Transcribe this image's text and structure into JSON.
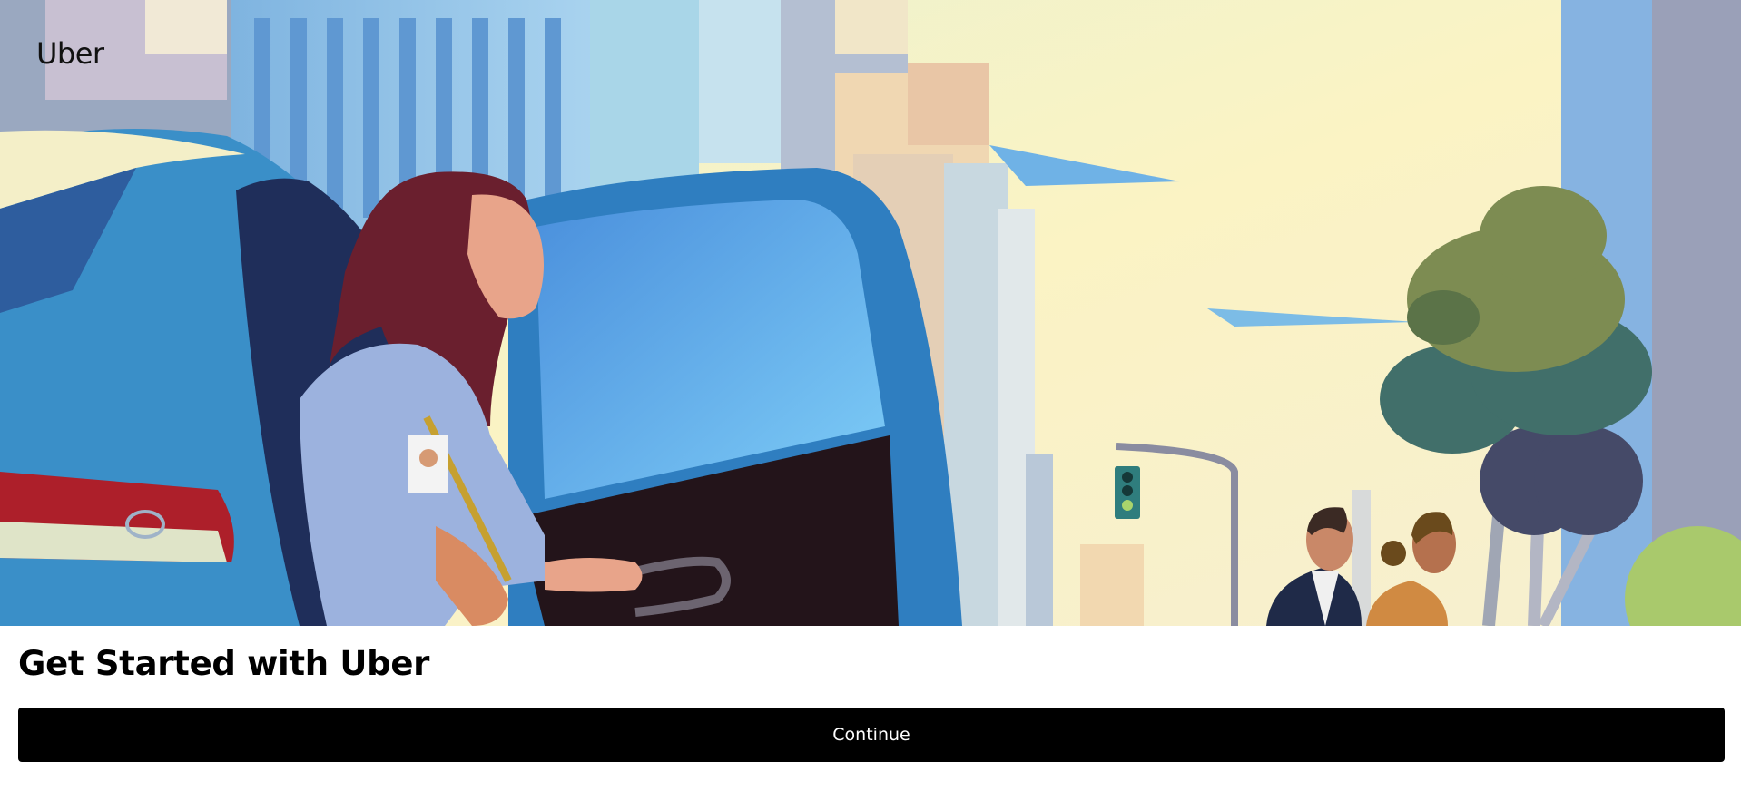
{
  "brand": {
    "logo_text": "Uber"
  },
  "hero": {
    "illustration": "woman-entering-car-city-street"
  },
  "main": {
    "title": "Get Started with Uber",
    "continue_label": "Continue"
  },
  "colors": {
    "button_bg": "#000000",
    "button_text": "#ffffff",
    "sky": "#f4f0c8",
    "car_blue": "#3a8fc8"
  }
}
